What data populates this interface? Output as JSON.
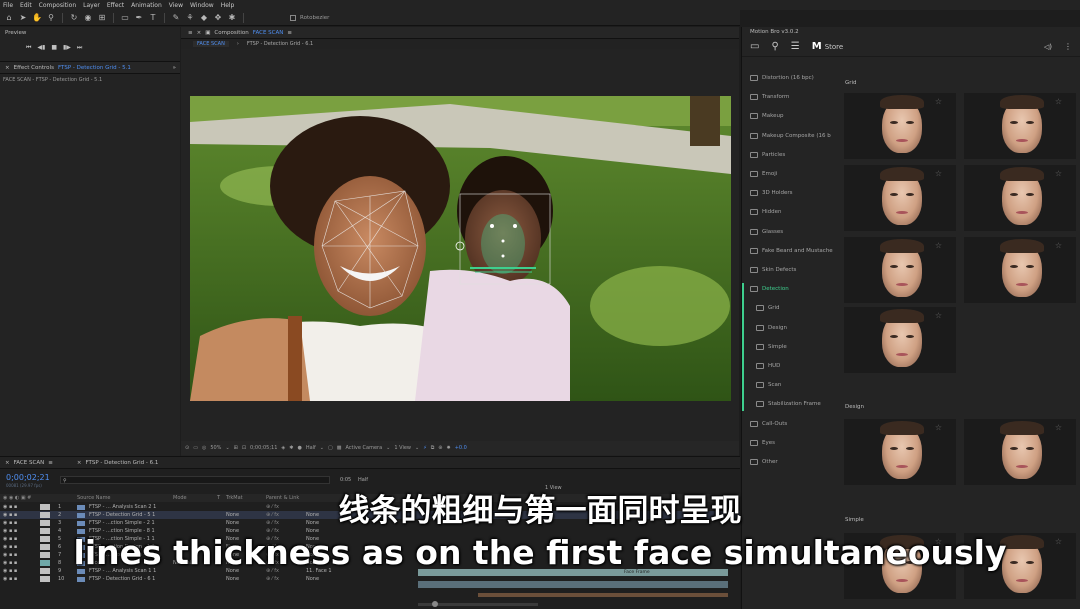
{
  "menu": [
    "File",
    "Edit",
    "Composition",
    "Layer",
    "Effect",
    "Animation",
    "View",
    "Window",
    "Help"
  ],
  "toolbar": {
    "checkbox_label": "Rotobezier"
  },
  "preview": {
    "title": "Preview"
  },
  "effect_controls": {
    "title": "Effect Controls",
    "layer": "FTSP - Detection Grid - 5.1",
    "breadcrumb": "FACE SCAN - FTSP - Detection Grid - 5.1"
  },
  "composition": {
    "title": "Composition",
    "name": "FACE SCAN",
    "tab": "FACE SCAN",
    "layer_tab": "FTSP - Detection Grid - 6.1"
  },
  "comp_bar": {
    "zoom": "50%",
    "timecode": "0;00;05;11",
    "resolution": "Half",
    "camera": "Active Camera",
    "views": "1 View",
    "exposure": "+0.0"
  },
  "timeline": {
    "tab1": "FACE SCAN",
    "tab2": "FTSP - Detection Grid - 6.1",
    "timecode": "0;00;02;21",
    "fps": "00081 (29.97 fps)",
    "header": {
      "source": "Source Name",
      "mode": "Mode",
      "t": "T",
      "trkmat": "TrkMat",
      "parent": "Parent & Link"
    },
    "rows": [
      {
        "num": "1",
        "name": "FTSP - ... Analysis Scan 2 1",
        "mode": "",
        "trk": "",
        "parent": ""
      },
      {
        "num": "2",
        "name": "FTSP - Detection Grid - 5 1",
        "mode": "",
        "trk": "None",
        "parent": "None"
      },
      {
        "num": "3",
        "name": "FTSP - ...ction Simple - 2 1",
        "mode": "",
        "trk": "None",
        "parent": "None"
      },
      {
        "num": "4",
        "name": "FTSP - ...ction Simple - 8 1",
        "mode": "",
        "trk": "None",
        "parent": "None"
      },
      {
        "num": "5",
        "name": "FTSP - ...ction Simple - 1 1",
        "mode": "",
        "trk": "None",
        "parent": "None"
      },
      {
        "num": "6",
        "name": "FTSP - ...ction Design - 1 1",
        "mode": "",
        "trk": "None",
        "parent": "None"
      },
      {
        "num": "7",
        "name": "FTSP - ...ction Design - 1 1",
        "mode": "",
        "trk": "None",
        "parent": "None"
      },
      {
        "num": "8",
        "name": "Face 2",
        "mode": "Normal",
        "trk": "None",
        "parent": "None"
      },
      {
        "num": "9",
        "name": "FTSP - ... Analysis Scan 1 1",
        "mode": "",
        "trk": "None",
        "parent": "11. Face 1"
      },
      {
        "num": "10",
        "name": "FTSP - Detection Grid - 6 1",
        "mode": "",
        "trk": "None",
        "parent": "None"
      }
    ],
    "ruler_left": "0:05",
    "ruler_half": "Half",
    "ruler_view": "1 View",
    "clip_label": "Face Frame"
  },
  "motion_bro": {
    "title": "Motion Bro v3.0.2",
    "store": "Store",
    "categories": [
      {
        "label": "Distortion (16 bpc)",
        "sub": false,
        "active": false
      },
      {
        "label": "Transform",
        "sub": false,
        "active": false
      },
      {
        "label": "Makeup",
        "sub": false,
        "active": false
      },
      {
        "label": "Makeup Composite (16 b",
        "sub": false,
        "active": false
      },
      {
        "label": "Particles",
        "sub": false,
        "active": false
      },
      {
        "label": "Emoji",
        "sub": false,
        "active": false
      },
      {
        "label": "3D Holders",
        "sub": false,
        "active": false
      },
      {
        "label": "Hidden",
        "sub": false,
        "active": false
      },
      {
        "label": "Glasses",
        "sub": false,
        "active": false
      },
      {
        "label": "Fake Beard and Mustache",
        "sub": false,
        "active": false
      },
      {
        "label": "Skin Defects",
        "sub": false,
        "active": false
      },
      {
        "label": "Detection",
        "sub": false,
        "active": true
      },
      {
        "label": "Grid",
        "sub": true,
        "active": false
      },
      {
        "label": "Design",
        "sub": true,
        "active": false
      },
      {
        "label": "Simple",
        "sub": true,
        "active": false
      },
      {
        "label": "HUD",
        "sub": true,
        "active": false
      },
      {
        "label": "Scan",
        "sub": true,
        "active": false
      },
      {
        "label": "Stabilization Frame",
        "sub": true,
        "active": false
      },
      {
        "label": "Call-Outs",
        "sub": false,
        "active": false
      },
      {
        "label": "Eyes",
        "sub": false,
        "active": false
      },
      {
        "label": "Other",
        "sub": false,
        "active": false
      }
    ],
    "sections": {
      "grid": "Grid",
      "design": "Design",
      "simple": "Simple"
    }
  },
  "subtitles": {
    "zh": "线条的粗细与第一面同时呈现",
    "en": "lines thickness as on the first face simultaneously"
  },
  "colors": {
    "accent": "#4f8ef0",
    "detection": "#3ecf8e"
  }
}
